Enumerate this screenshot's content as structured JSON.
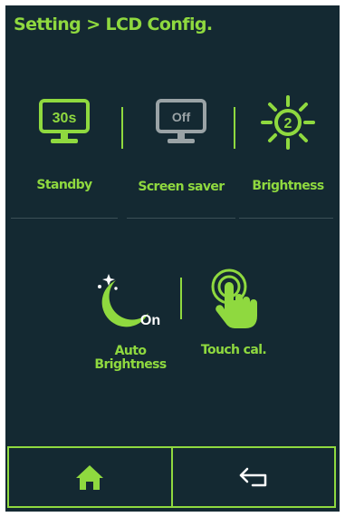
{
  "header": {
    "title": "Setting > LCD Config."
  },
  "tiles": {
    "standby": {
      "label": "Standby",
      "value": "30s",
      "icon": "monitor-icon"
    },
    "screen_saver": {
      "label": "Screen saver",
      "value": "Off",
      "icon": "monitor-icon"
    },
    "brightness": {
      "label": "Brightness",
      "value": "2",
      "icon": "sun-icon"
    },
    "auto_brightness": {
      "label_line1": "Auto",
      "label_line2": "Brightness",
      "state": "On",
      "icon": "moon-stars-icon"
    },
    "touch_cal": {
      "label": "Touch cal.",
      "icon": "touch-hand-icon"
    }
  },
  "nav": {
    "home_icon": "home-icon",
    "back_icon": "back-arrow-icon"
  },
  "colors": {
    "background": "#142932",
    "accent": "#8fd93f",
    "disabled": "#9aa3a6",
    "divider": "#3c4f57"
  }
}
